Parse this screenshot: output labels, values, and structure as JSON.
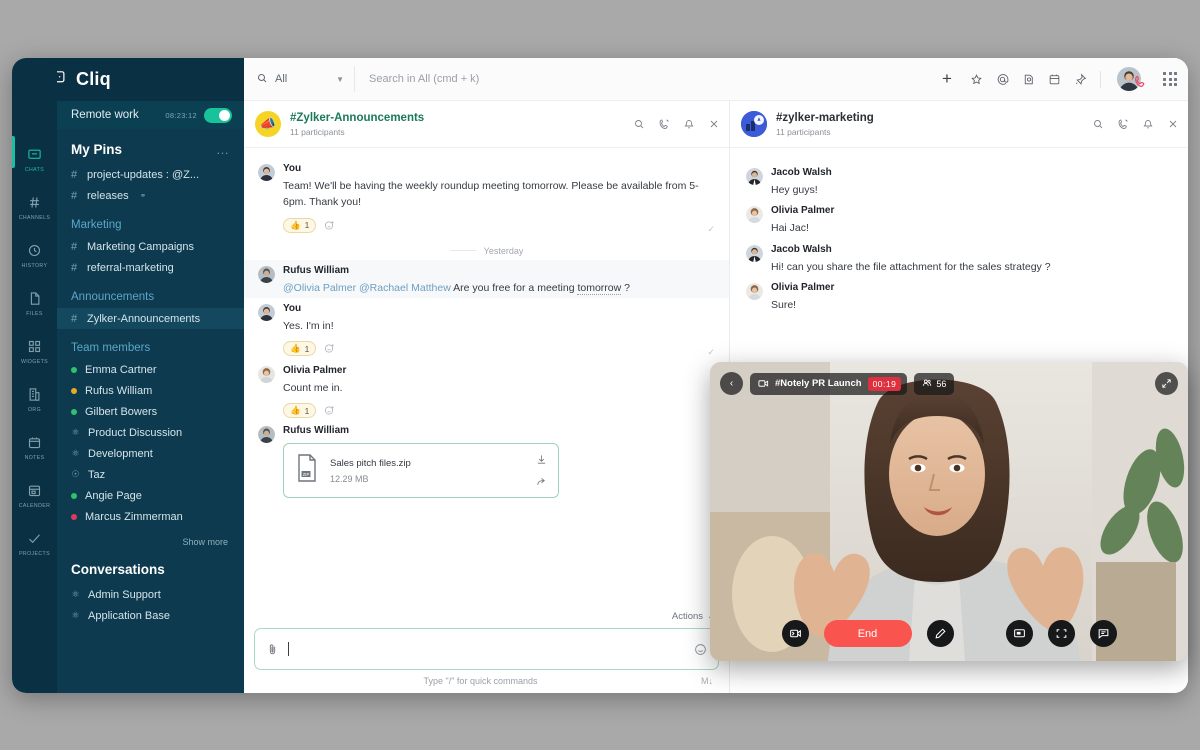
{
  "app": {
    "brand": "Cliq",
    "menu_icon": "hamburger-icon",
    "logo_icon": "cliq-chat-logo-icon"
  },
  "status_bar": {
    "label": "Remote work",
    "time": "08:23:12",
    "toggle_on": true,
    "toggle_color": "#17c39a"
  },
  "rail": {
    "items": [
      {
        "label": "CHATS",
        "icon": "chat-icon",
        "active": true
      },
      {
        "label": "CHANNELS",
        "icon": "hash-icon",
        "active": false
      },
      {
        "label": "HISTORY",
        "icon": "history-clock-icon",
        "active": false
      },
      {
        "label": "FILES",
        "icon": "file-icon",
        "active": false
      },
      {
        "label": "WIDGETS",
        "icon": "widgets-grid-icon",
        "active": false
      },
      {
        "label": "ORG",
        "icon": "org-building-icon",
        "active": false
      },
      {
        "label": "NOTES",
        "icon": "notes-icon",
        "active": false
      },
      {
        "label": "CALENDER",
        "icon": "calendar-icon",
        "active": false
      },
      {
        "label": "PROJECTS",
        "icon": "projects-check-icon",
        "active": false
      }
    ]
  },
  "sidebar": {
    "pins_title": "My Pins",
    "pins_more": "…",
    "pins": [
      {
        "label": "project-updates : @Z...",
        "icon": "hash-icon"
      },
      {
        "label": "releases",
        "icon": "hash-icon",
        "trailing_icon": "link-icon"
      }
    ],
    "marketing_title": "Marketing",
    "marketing": [
      {
        "label": "Marketing Campaigns",
        "icon": "hash-icon"
      },
      {
        "label": "referral-marketing",
        "icon": "hash-icon"
      }
    ],
    "announcements_title": "Announcements",
    "announcements": [
      {
        "label": "Zylker-Announcements",
        "icon": "hash-icon",
        "selected": true
      }
    ],
    "team_title": "Team members",
    "team": [
      {
        "label": "Emma  Cartner",
        "status": "green"
      },
      {
        "label": "Rufus William",
        "status": "amber"
      },
      {
        "label": "Gilbert Bowers",
        "status": "green"
      },
      {
        "label": "Product Discussion",
        "status": "group"
      },
      {
        "label": "Development",
        "status": "group"
      },
      {
        "label": "Taz",
        "status": "bot"
      },
      {
        "label": "Angie Page",
        "status": "green"
      },
      {
        "label": "Marcus Zimmerman",
        "status": "red"
      }
    ],
    "show_more": "Show more",
    "conversations_title": "Conversations",
    "conversations": [
      {
        "label": "Admin Support",
        "status": "group"
      },
      {
        "label": "Application Base",
        "status": "group"
      }
    ]
  },
  "topbar": {
    "scope_label": "All",
    "search_icon": "search-icon",
    "chevron_icon": "chevron-down-icon",
    "search_placeholder": "Search in All (cmd + k)",
    "plus_label": "+",
    "icons": [
      {
        "name": "star-icon"
      },
      {
        "name": "mention-at-icon"
      },
      {
        "name": "reminder-icon"
      },
      {
        "name": "calendar-icon"
      },
      {
        "name": "pin-icon"
      }
    ],
    "avatar_name": "avatar",
    "call_badge_icon": "phone-icon",
    "apps_icon": "apps-grid-icon"
  },
  "left_pane": {
    "channel": "#Zylker-Announcements",
    "participants": "11 participants",
    "avatar_emoji": "📣",
    "actions": [
      {
        "name": "search-icon"
      },
      {
        "name": "call-icon"
      },
      {
        "name": "bell-icon"
      },
      {
        "name": "close-icon"
      }
    ],
    "day_separator": "Yesterday",
    "messages": [
      {
        "author": "You",
        "text": "Team! We'll be having the weekly roundup meeting tomorrow. Please be available from 5-6pm. Thank you!",
        "reaction_emoji": "👍",
        "reaction_count": "1",
        "highlight": false
      },
      {
        "author": "Rufus William",
        "mention1": "@Olivia Palmer",
        "mention2": "@Rachael Matthew",
        "text_a": " Are you free for a meeting ",
        "text_b": "tomorrow",
        "text_c": " ?",
        "highlight": true
      },
      {
        "author": "You",
        "text": "Yes. I'm in!",
        "reaction_emoji": "👍",
        "reaction_count": "1",
        "highlight": false
      },
      {
        "author": "Olivia Palmer",
        "text": "Count me in.",
        "reaction_emoji": "👍",
        "reaction_count": "1",
        "highlight": false
      },
      {
        "author": "Rufus William",
        "file_name": "Sales pitch files.zip",
        "file_size": "12.29 MB",
        "file_type_label": "ZIP",
        "download_icon": "download-icon",
        "forward_icon": "forward-icon"
      }
    ],
    "composer": {
      "actions_label": "Actions",
      "actions_chevron": "⌄",
      "attach_icon": "paperclip-icon",
      "emoji_icon": "emoji-icon",
      "value": "",
      "hint": "Type \"/\" for quick commands",
      "right_hint": "M↓"
    }
  },
  "right_pane": {
    "channel": "#zylker-marketing",
    "participants": "11 participants",
    "actions": [
      {
        "name": "search-icon"
      },
      {
        "name": "call-icon"
      },
      {
        "name": "bell-icon"
      },
      {
        "name": "close-icon"
      }
    ],
    "messages": [
      {
        "author": "Jacob Walsh",
        "text": "Hey guys!"
      },
      {
        "author": "Olivia Palmer",
        "text": "Hai Jac!"
      },
      {
        "author": "Jacob Walsh",
        "text": "Hi! can you share the file attachment for the sales strategy ?"
      },
      {
        "author": "Olivia Palmer",
        "text": "Sure!"
      }
    ]
  },
  "call": {
    "back_icon": "chevron-left-icon",
    "camera_icon": "video-camera-icon",
    "title": "#Notely PR Launch",
    "timer": "00:19",
    "timer_color": "#e0303f",
    "participants_icon": "people-icon",
    "participants_count": "56",
    "expand_icon": "expand-icon",
    "controls": [
      {
        "name": "switch-camera-icon"
      },
      {
        "name": "annotate-pen-icon"
      },
      {
        "name": "screen-share-icon"
      },
      {
        "name": "fullscreen-icon"
      },
      {
        "name": "chat-bubble-icon"
      }
    ],
    "end_label": "End",
    "end_color": "#f9554e"
  }
}
